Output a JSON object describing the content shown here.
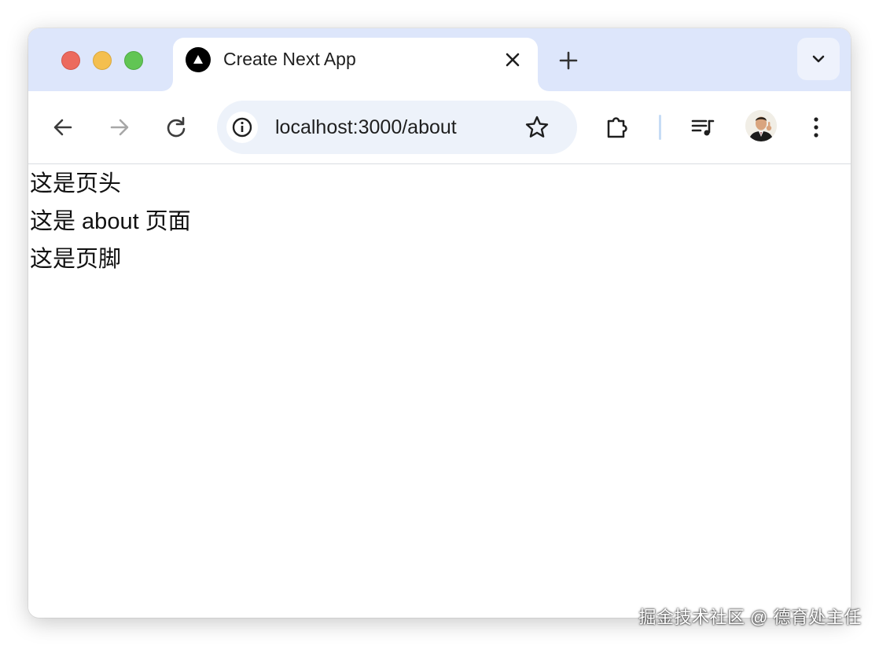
{
  "window": {
    "controls": [
      "close",
      "minimize",
      "zoom"
    ]
  },
  "tab": {
    "title": "Create Next App",
    "favicon": "nextjs-triangle-icon"
  },
  "toolbar": {
    "back_icon": "arrow-left-icon",
    "forward_icon": "arrow-right-icon",
    "reload_icon": "reload-icon",
    "url": "localhost:3000/about",
    "site_info_icon": "info-icon",
    "bookmark_icon": "star-icon",
    "extensions_icon": "puzzle-icon",
    "media_icon": "playlist-music-icon",
    "menu_icon": "kebab-menu-icon"
  },
  "page": {
    "lines": [
      "这是页头",
      "这是 about 页面",
      "这是页脚"
    ]
  },
  "watermark": "掘金技术社区 @ 德育处主任",
  "colors": {
    "tabstrip_bg": "#dde6fb",
    "omnibox_bg": "#edf2fa",
    "close": "#ec6a5e",
    "minimize": "#f4bf4f",
    "zoom": "#61c554"
  }
}
